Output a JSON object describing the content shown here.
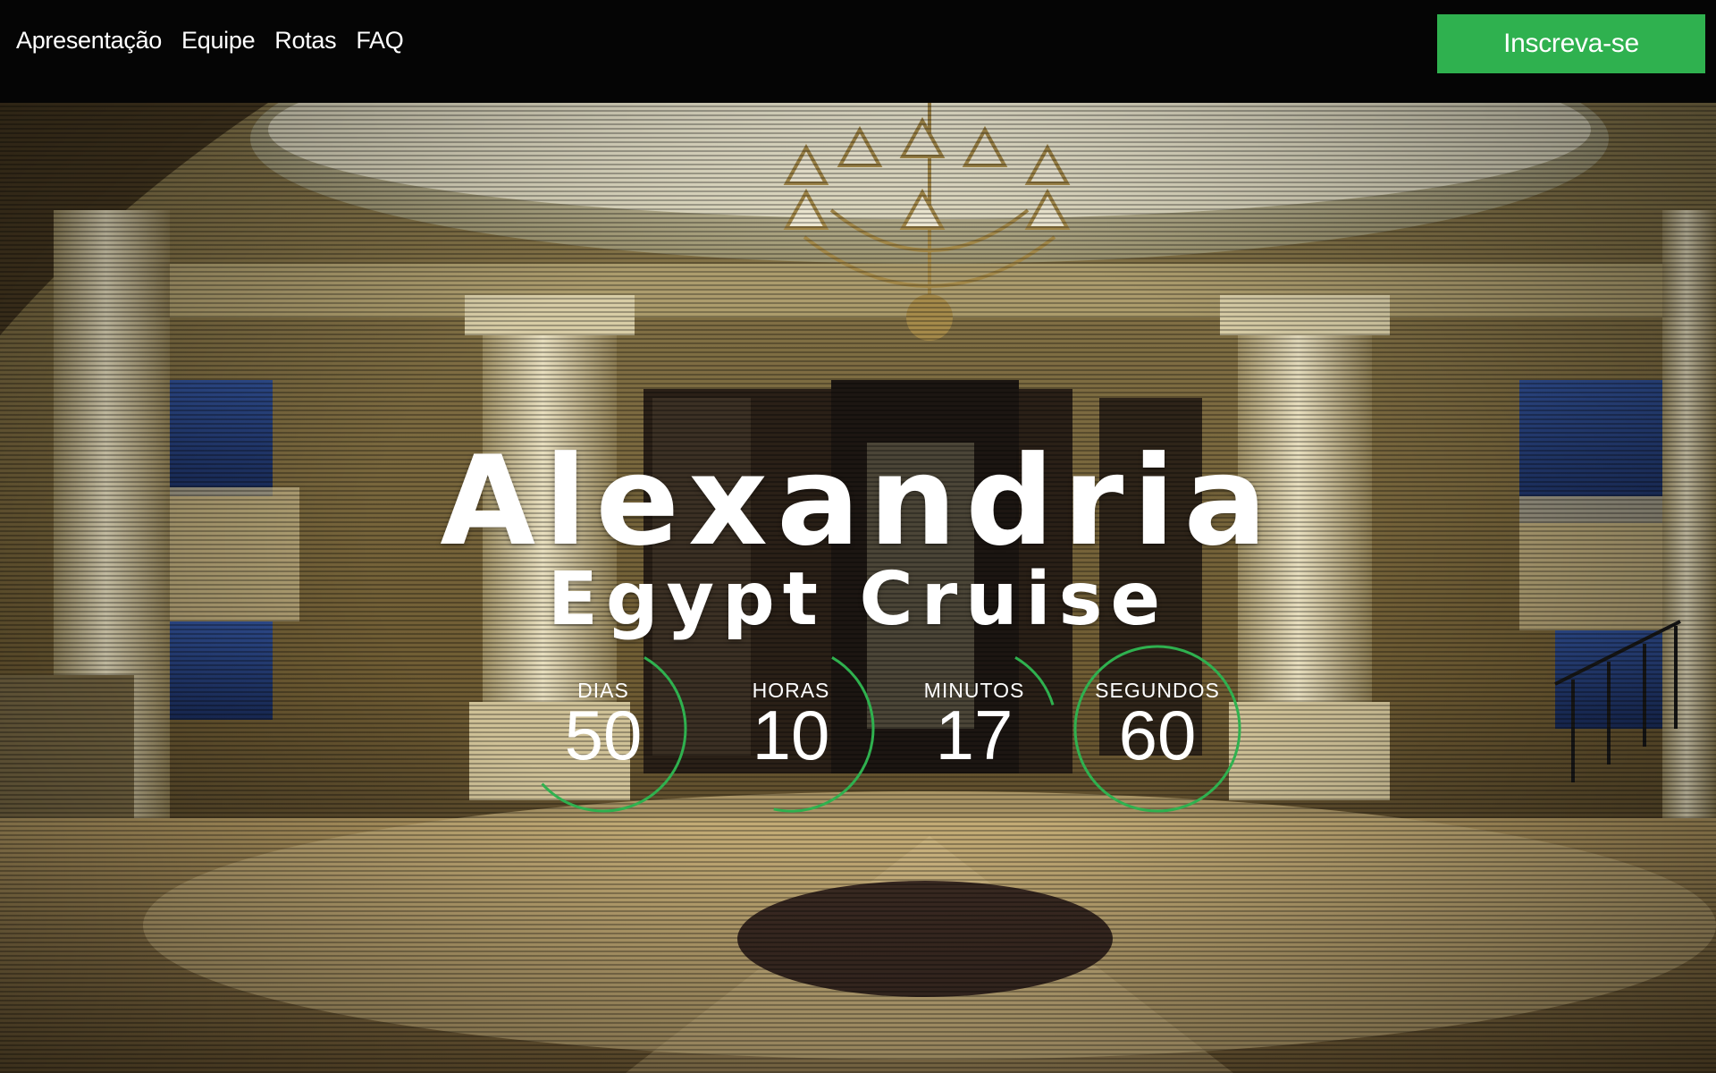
{
  "nav": {
    "links": [
      "Apresentação",
      "Equipe",
      "Rotas",
      "FAQ"
    ],
    "cta_label": "Inscreva-se"
  },
  "hero": {
    "title": "Alexandria",
    "subtitle": "Egypt Cruise"
  },
  "countdown": [
    {
      "label": "DIAS",
      "value": "50",
      "progress": 0.55
    },
    {
      "label": "HORAS",
      "value": "10",
      "progress": 0.45
    },
    {
      "label": "MINUTOS",
      "value": "17",
      "progress": 0.12
    },
    {
      "label": "SEGUNDOS",
      "value": "60",
      "progress": 1.0
    }
  ],
  "colors": {
    "accent": "#2fb14f",
    "topbar": "#050505"
  }
}
